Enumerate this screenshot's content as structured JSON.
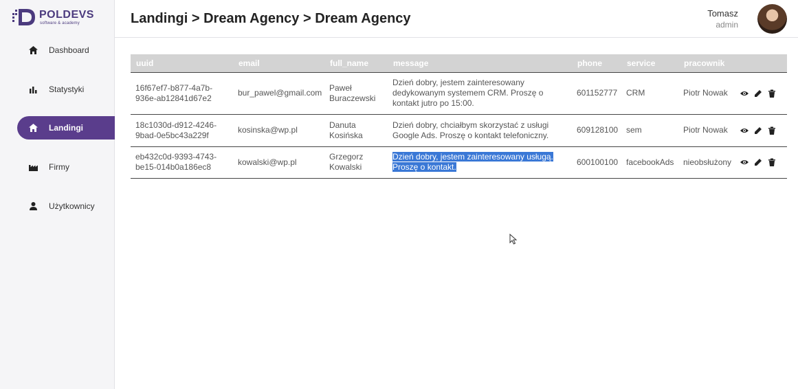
{
  "brand": {
    "name": "POLDEVS",
    "tagline": "software & academy",
    "color": "#4b3a7e"
  },
  "sidebar": {
    "items": [
      {
        "label": "Dashboard",
        "icon": "home-icon",
        "active": false
      },
      {
        "label": "Statystyki",
        "icon": "bar-chart-icon",
        "active": false
      },
      {
        "label": "Landingi",
        "icon": "home-icon",
        "active": true
      },
      {
        "label": "Firmy",
        "icon": "factory-icon",
        "active": false
      },
      {
        "label": "Użytkownicy",
        "icon": "user-icon",
        "active": false
      }
    ],
    "active_color": "#5a3d8c"
  },
  "header": {
    "breadcrumb": "Landingi > Dream Agency > Dream Agency"
  },
  "user": {
    "name": "Tomasz",
    "role": "admin"
  },
  "table": {
    "columns": [
      "uuid",
      "email",
      "full_name",
      "message",
      "phone",
      "service",
      "pracownik"
    ],
    "rows": [
      {
        "uuid": "16f67ef7-b877-4a7b-936e-ab12841d67e2",
        "email": "bur_pawel@gmail.com",
        "full_name": "Paweł Buraczewski",
        "message": "Dzień dobry, jestem zainteresowany dedykowanym systemem CRM. Proszę o kontakt jutro po 15:00.",
        "phone": "601152777",
        "service": "CRM",
        "pracownik": "Piotr Nowak"
      },
      {
        "uuid": "18c1030d-d912-4246-9bad-0e5bc43a229f",
        "email": "kosinska@wp.pl",
        "full_name": "Danuta Kosińska",
        "message": "Dzień dobry, chciałbym skorzystać z usługi Google Ads. Proszę o kontakt telefoniczny.",
        "phone": "609128100",
        "service": "sem",
        "pracownik": "Piotr Nowak"
      },
      {
        "uuid": "eb432c0d-9393-4743-be15-014b0a186ec8",
        "email": "kowalski@wp.pl",
        "full_name": "Grzegorz Kowalski",
        "message_line1": "Dzień dobry, jestem zainteresowany usługą.",
        "message_line2": "Proszę o kontakt.",
        "phone": "600100100",
        "service": "facebookAds",
        "pracownik": "nieobsłużony"
      }
    ]
  }
}
